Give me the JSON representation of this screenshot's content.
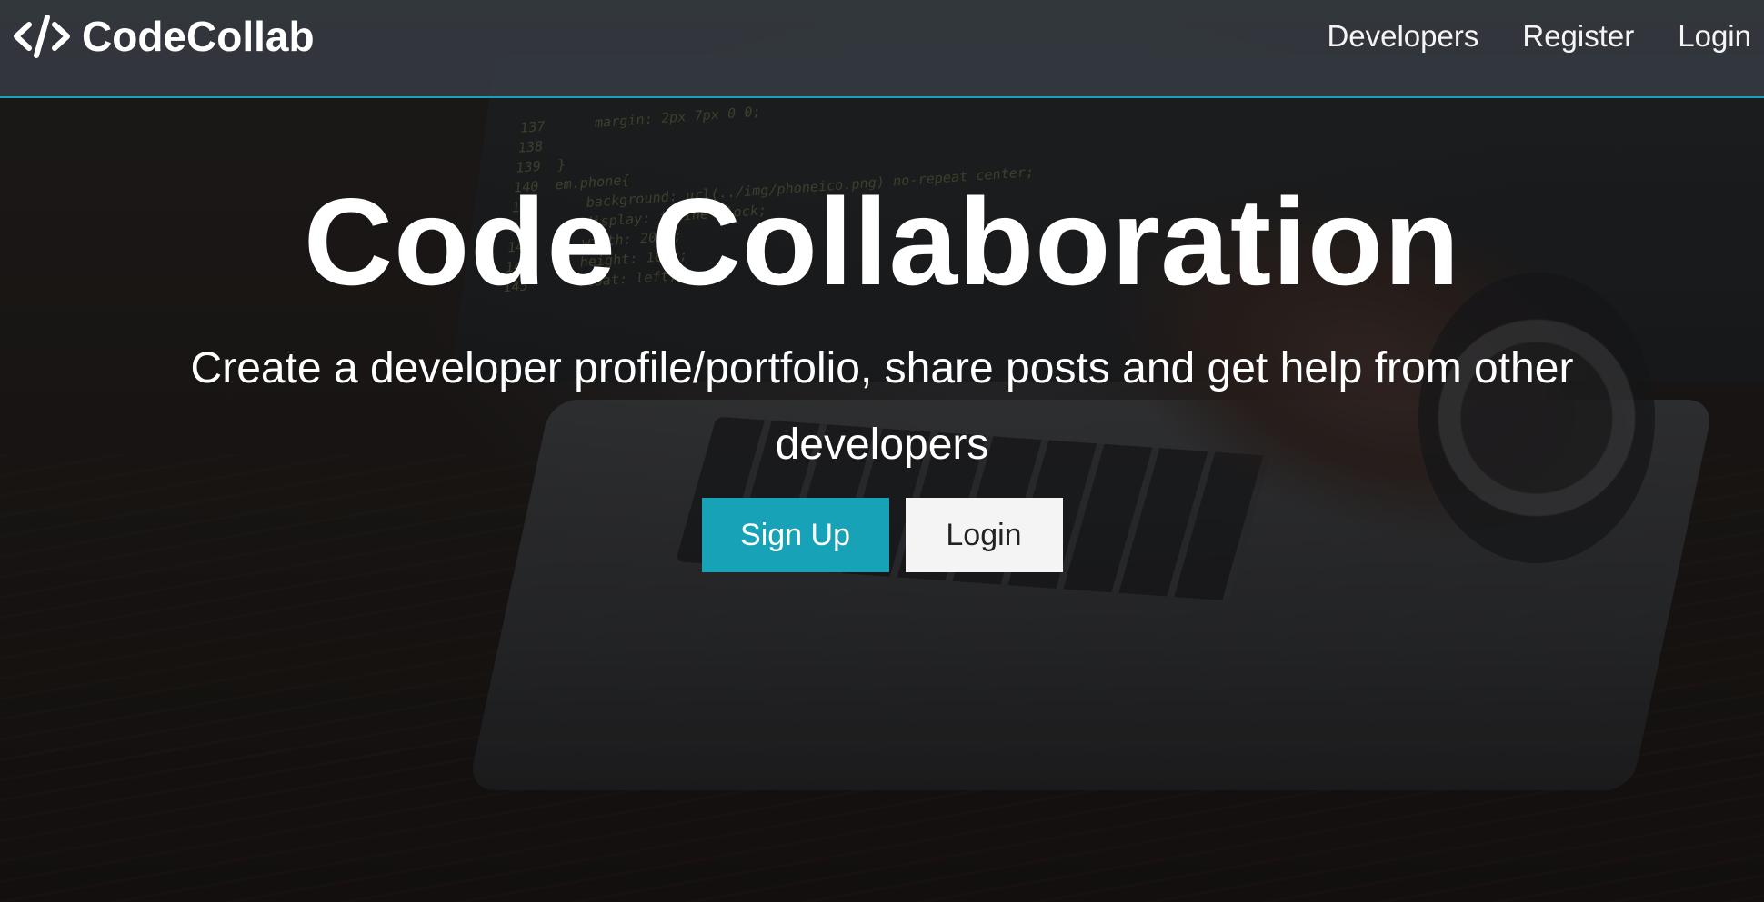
{
  "navbar": {
    "brand_icon": "code-icon",
    "brand_name": "CodeCollab",
    "links": [
      {
        "label": "Developers"
      },
      {
        "label": "Register"
      },
      {
        "label": "Login"
      }
    ],
    "accent_color": "#17a2b8"
  },
  "hero": {
    "title": "Code Collaboration",
    "lead": "Create a developer profile/portfolio, share posts and get help from other developers",
    "buttons": {
      "primary_label": "Sign Up",
      "secondary_label": "Login"
    }
  },
  "colors": {
    "primary": "#17a2b8",
    "navbar_bg": "#343a40",
    "light_button": "#f4f4f4",
    "text": "#ffffff"
  }
}
